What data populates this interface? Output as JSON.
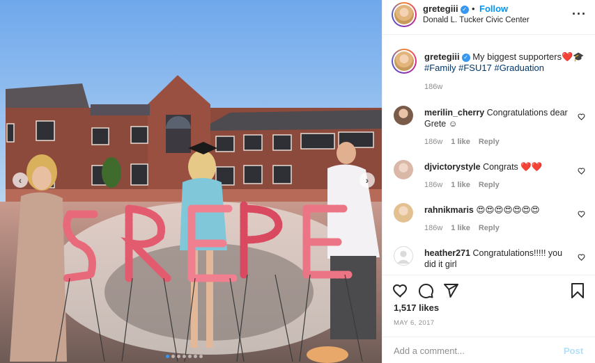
{
  "photo": {
    "alt_subject": "graduation-photo",
    "carousel_dots": 7,
    "active_dot": 0,
    "prev_icon": "chevron-left-icon",
    "next_icon": "chevron-right-icon"
  },
  "header": {
    "username": "gretegiii",
    "separator": "•",
    "follow_label": "Follow",
    "location": "Donald L. Tucker Civic Center",
    "more_icon": "more-options-icon"
  },
  "caption": {
    "username": "gretegiii",
    "text": "My biggest supporters",
    "emoji": "❤️🎓",
    "hashtags": [
      "#Family",
      "#FSU17",
      "#Graduation"
    ],
    "time": "186w"
  },
  "comments": [
    {
      "username": "merilin_cherry",
      "text": "Congratulations dear Grete ☺︎",
      "time": "186w",
      "likes": "1 like",
      "reply": "Reply",
      "avatar_color": "#8a6a5a"
    },
    {
      "username": "djvictorystyle",
      "text": "Congrats ❤️❤️",
      "time": "186w",
      "likes": "1 like",
      "reply": "Reply",
      "avatar_color": "#d9b8a8"
    },
    {
      "username": "rahnikmaris",
      "text": "😍😍😍😍😍😍😍",
      "time": "186w",
      "likes": "1 like",
      "reply": "Reply",
      "avatar_color": "#e2c08f"
    },
    {
      "username": "heather271",
      "text": "Congratulations!!!!! you did it girl",
      "avatar_color": "#dbdbdb"
    }
  ],
  "actions": {
    "likes": "1,517 likes",
    "date": "MAY 6, 2017",
    "comment_placeholder": "Add a comment...",
    "post_label": "Post"
  },
  "colors": {
    "accent": "#0095f6",
    "verified": "#3897f0",
    "hashtag": "#00376b",
    "muted": "#8e8e8e"
  }
}
